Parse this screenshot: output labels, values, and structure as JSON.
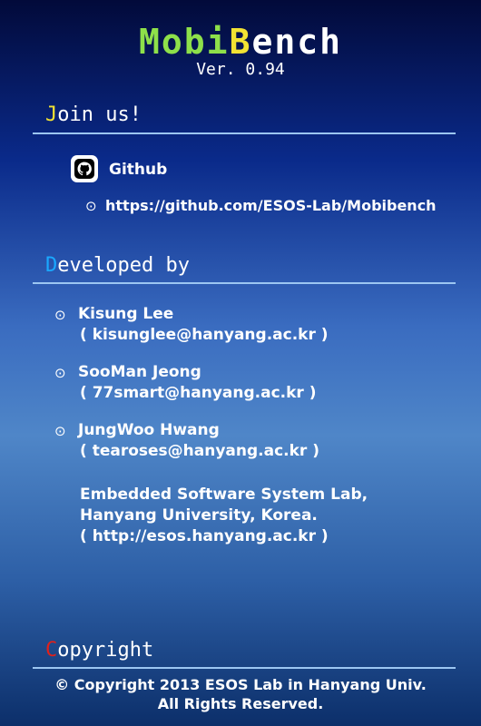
{
  "app": {
    "logo_first": "M",
    "logo_mid": "obi",
    "logo_b": "B",
    "logo_rest": "ench",
    "version": "Ver. 0.94"
  },
  "join": {
    "title_initial": "J",
    "title_rest": "oin us!",
    "initial_color": "#f2e233",
    "github_label": "Github",
    "github_url": "https://github.com/ESOS-Lab/Mobibench"
  },
  "developers": {
    "title_initial": "D",
    "title_rest": "eveloped by",
    "initial_color": "#1aa8ff",
    "people": [
      {
        "name": "Kisung Lee",
        "email": "( kisunglee@hanyang.ac.kr )"
      },
      {
        "name": "SooMan Jeong",
        "email": "( 77smart@hanyang.ac.kr )"
      },
      {
        "name": "JungWoo Hwang",
        "email": "( tearoses@hanyang.ac.kr )"
      }
    ],
    "lab_line1": "Embedded Software System Lab,",
    "lab_line2": "Hanyang University, Korea.",
    "lab_url": "( http://esos.hanyang.ac.kr )"
  },
  "copyright": {
    "title_initial": "C",
    "title_rest": "opyright",
    "initial_color": "#e0201a",
    "line1": "© Copyright 2013 ESOS Lab in Hanyang Univ.",
    "line2": "All Rights Reserved."
  },
  "bullet_glyph": "⊙",
  "icons": {
    "github": "github-icon",
    "bullet": "bullet-icon"
  }
}
